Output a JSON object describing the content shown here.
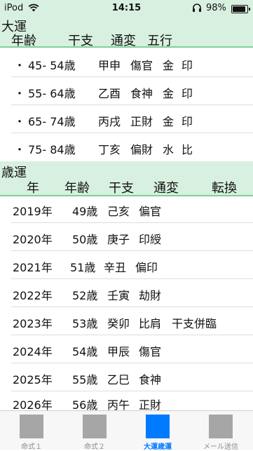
{
  "status_bar": {
    "carrier": "iPod",
    "wifi_icon": "wifi-icon",
    "time": "14:15",
    "headphones_icon": "headphones-icon",
    "battery_percent": "98%",
    "battery_level": 0.98
  },
  "taiun": {
    "title": "大運",
    "columns": {
      "age": "年齢",
      "kanshi": "干支",
      "tsuhen": "通変",
      "gogyo": "五行"
    },
    "rows": [
      {
        "bullet": "・",
        "age": "45- 54歳",
        "kanshi": "甲申",
        "tsuhen": "傷官",
        "element": "金",
        "relation": "印"
      },
      {
        "bullet": "・",
        "age": "55- 64歳",
        "kanshi": "乙酉",
        "tsuhen": "食神",
        "element": "金",
        "relation": "印"
      },
      {
        "bullet": "・",
        "age": "65- 74歳",
        "kanshi": "丙戌",
        "tsuhen": "正財",
        "element": "金",
        "relation": "印"
      },
      {
        "bullet": "・",
        "age": "75- 84歳",
        "kanshi": "丁亥",
        "tsuhen": "偏財",
        "element": "水",
        "relation": "比"
      }
    ]
  },
  "saiun": {
    "title": "歳運",
    "columns": {
      "year": "年",
      "age": "年齢",
      "kanshi": "干支",
      "tsuhen": "通変",
      "tenkan": "転換"
    },
    "rows": [
      {
        "year": "2019年",
        "age": "49歳",
        "kanshi": "己亥",
        "tsuhen": "偏官",
        "tenkan": ""
      },
      {
        "year": "2020年",
        "age": "50歳",
        "kanshi": "庚子",
        "tsuhen": "印綬",
        "tenkan": ""
      },
      {
        "year": "2021年",
        "age": "51歳",
        "kanshi": "辛丑",
        "tsuhen": "偏印",
        "tenkan": ""
      },
      {
        "year": "2022年",
        "age": "52歳",
        "kanshi": "壬寅",
        "tsuhen": "劫財",
        "tenkan": ""
      },
      {
        "year": "2023年",
        "age": "53歳",
        "kanshi": "癸卯",
        "tsuhen": "比肩",
        "tenkan": "干支併臨"
      },
      {
        "year": "2024年",
        "age": "54歳",
        "kanshi": "甲辰",
        "tsuhen": "傷官",
        "tenkan": ""
      },
      {
        "year": "2025年",
        "age": "55歳",
        "kanshi": "乙巳",
        "tsuhen": "食神",
        "tenkan": ""
      },
      {
        "year": "2026年",
        "age": "56歳",
        "kanshi": "丙午",
        "tsuhen": "正財",
        "tenkan": ""
      }
    ]
  },
  "tab_bar": {
    "tabs": [
      {
        "label": "命式１",
        "active": false
      },
      {
        "label": "命式２",
        "active": false
      },
      {
        "label": "大運歳運",
        "active": true
      },
      {
        "label": "メール送信",
        "active": false
      }
    ]
  },
  "colors": {
    "header_bg": "#d8f0e0",
    "header_border": "#7fcf9c",
    "accent": "#007aff",
    "tab_icon_inactive": "#a6a6a6"
  }
}
